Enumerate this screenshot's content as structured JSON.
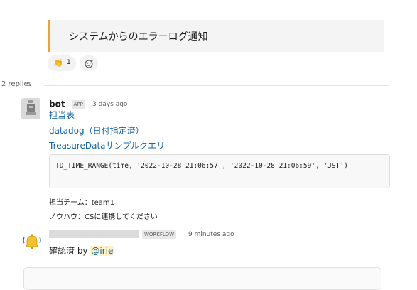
{
  "quote": {
    "text": "システムからのエラーログ通知",
    "bar_color": "#e8a33d"
  },
  "reactions": {
    "emoji_label": "→→",
    "count": "1",
    "emoji_icon": "raised-hands-icon",
    "add_icon": "add-reaction-icon"
  },
  "thread": {
    "replies_label": "2 replies"
  },
  "bot_message": {
    "sender": "bot",
    "badge": "APP",
    "timestamp": "3 days ago",
    "links": [
      "担当表",
      "datadog（日付指定済）",
      "TreasureDataサンプルクエリ"
    ],
    "code": "TD_TIME_RANGE(time, '2022-10-28 21:06:57', '2022-10-28 21:06:59', 'JST')",
    "line1": "担当チーム：team1",
    "line2": "ノウハウ：CSに連携してください",
    "link_color": "#1264a3"
  },
  "workflow_message": {
    "badge": "WORKFLOW",
    "timestamp": "9 minutes ago",
    "confirm_prefix": "確認済 by ",
    "mention": "@irie",
    "icon": "bell-icon"
  }
}
